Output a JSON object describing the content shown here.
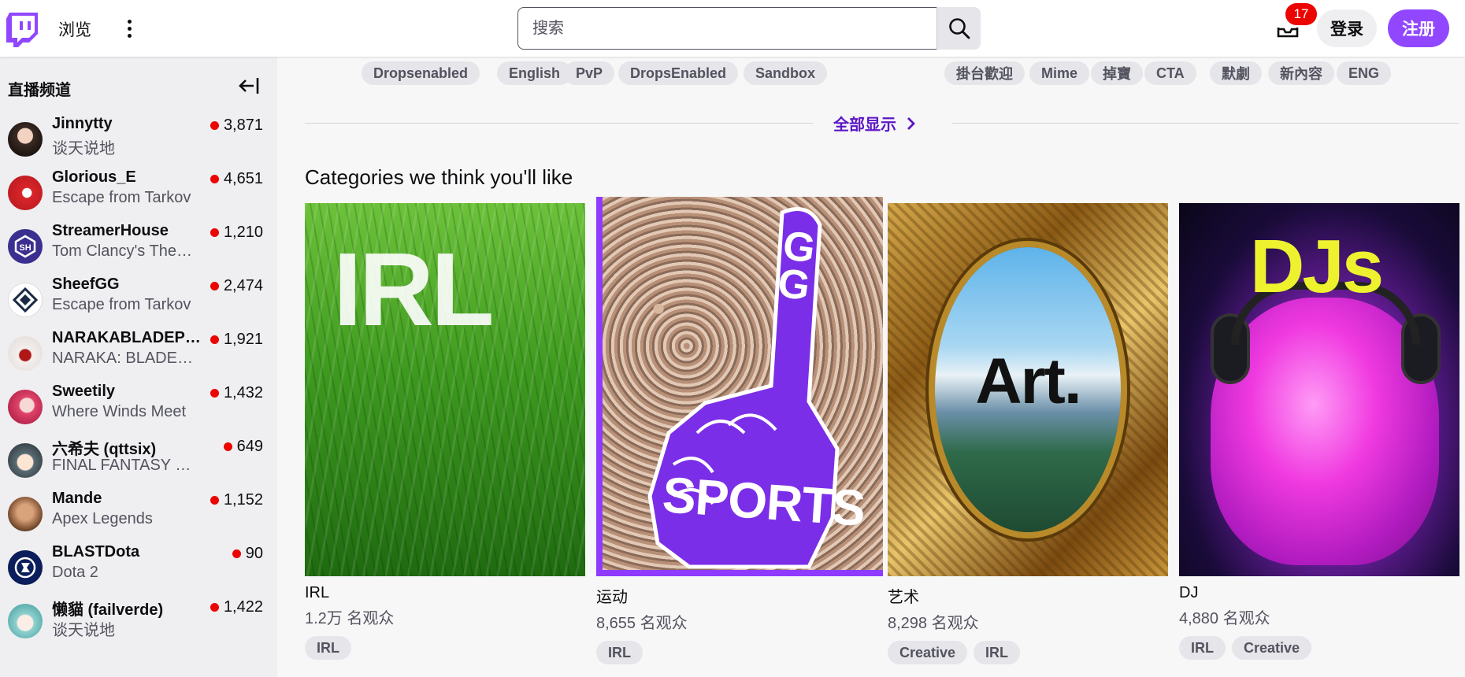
{
  "nav": {
    "browse": "浏览",
    "search_placeholder": "搜索",
    "inbox_badge": "17",
    "login": "登录",
    "signup": "注册"
  },
  "sidebar": {
    "title": "直播频道",
    "channels": [
      {
        "name": "Jinnytty",
        "game": "谈天说地",
        "viewers": "3,871"
      },
      {
        "name": "Glorious_E",
        "game": "Escape from Tarkov",
        "viewers": "4,651"
      },
      {
        "name": "StreamerHouse",
        "game": "Tom Clancy's The Division",
        "viewers": "1,210"
      },
      {
        "name": "SheefGG",
        "game": "Escape from Tarkov",
        "viewers": "2,474"
      },
      {
        "name": "NARAKABLADEPOINT",
        "game": "NARAKA: BLADEPOINT",
        "viewers": "1,921"
      },
      {
        "name": "Sweetily",
        "game": "Where Winds Meet",
        "viewers": "1,432"
      },
      {
        "name": "六希夫 (qttsix)",
        "game": "FINAL FANTASY XIV",
        "viewers": "649"
      },
      {
        "name": "Mande",
        "game": "Apex Legends",
        "viewers": "1,152"
      },
      {
        "name": "BLASTDota",
        "game": "Dota 2",
        "viewers": "90"
      },
      {
        "name": "懒貓 (failverde)",
        "game": "谈天说地",
        "viewers": "1,422"
      }
    ]
  },
  "main": {
    "tags_left": [
      "Dropsenabled",
      "English",
      "PvP",
      "DropsEnabled",
      "Sandbox"
    ],
    "tags_right": [
      "掛台歡迎",
      "Mime",
      "掉寶",
      "CTA",
      "默劇",
      "新內容",
      "ENG"
    ],
    "show_all": "全部显示",
    "section_title": "Categories we think you'll like",
    "cards": [
      {
        "name": "IRL",
        "viewers": "1.2万 名观众",
        "tags": [
          "IRL"
        ],
        "art_text": "IRL"
      },
      {
        "name": "运动",
        "viewers": "8,655 名观众",
        "tags": [
          "IRL"
        ],
        "art_text": "SPORTS",
        "art_text2": "GG"
      },
      {
        "name": "艺术",
        "viewers": "8,298 名观众",
        "tags": [
          "Creative",
          "IRL"
        ],
        "art_text": "Art."
      },
      {
        "name": "DJ",
        "viewers": "4,880 名观众",
        "tags": [
          "IRL",
          "Creative"
        ],
        "art_text": "DJs"
      }
    ]
  },
  "colors": {
    "brand": "#9147ff",
    "link": "#5c16c5",
    "live": "#eb0400"
  }
}
